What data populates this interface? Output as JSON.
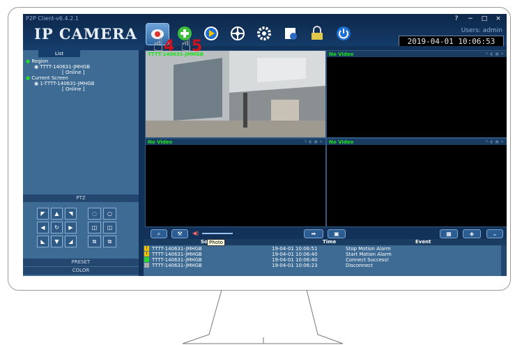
{
  "app": {
    "version": "P2P Client-v6.4.2.1",
    "brand": "IP CAMERA",
    "users": "Users: admin",
    "clock": "2019-04-01  10:06:53",
    "window_controls": [
      "?",
      "−",
      "□",
      "×"
    ]
  },
  "toolbar": {
    "buttons": [
      "camera-icon",
      "add-icon",
      "play-icon",
      "ptz-icon",
      "settings-icon",
      "config-icon",
      "lock-icon",
      "power-icon"
    ],
    "callouts": [
      "4",
      "5"
    ]
  },
  "left_panel": {
    "list_tab": "List",
    "tree": {
      "region": "Region",
      "device1": "TTTT-140631-JMHGB",
      "device1_status": "[ Online ]",
      "current_screen": "Current Screen",
      "device2": "1-TTTT-140631-JMHGB",
      "device2_status": "[ Online ]"
    },
    "ptz_label": "PTZ",
    "preset_label": "PRESET",
    "color_label": "COLOR"
  },
  "video_cells": [
    {
      "label": "TTTT-140631-JMHGB"
    },
    {
      "label": "No Video"
    },
    {
      "label": "No Video"
    },
    {
      "label": "No Video"
    }
  ],
  "tooltip": "Photo",
  "events": {
    "headers": {
      "source": "Source",
      "time": "Time",
      "event": "Event"
    },
    "rows": [
      {
        "icon": "warning-icon",
        "source": "TTTT-140631-JMHGB",
        "time": "19-04-01 10:06:51",
        "event": "Stop Motion Alarm"
      },
      {
        "icon": "warning-icon",
        "source": "TTTT-140631-JMHGB",
        "time": "19-04-01 10:06:40",
        "event": "Start Motion Alarm"
      },
      {
        "icon": "connect-icon",
        "source": "TTTT-140631-JMHGB",
        "time": "19-04-01 10:06:40",
        "event": "Connect Success!"
      },
      {
        "icon": "disconnect-icon",
        "source": "TTTT-140631-JMHGB",
        "time": "19-04-01 10:06:23",
        "event": "Disconnect"
      }
    ]
  },
  "colors": {
    "accent": "#1de01d",
    "panel": "#3e6b94",
    "dark": "#13325a",
    "callout": "#d0121a"
  }
}
